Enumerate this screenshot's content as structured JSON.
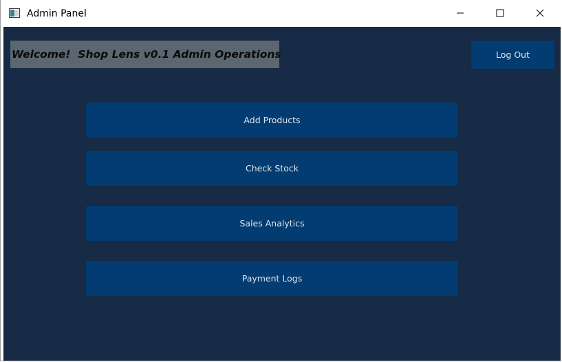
{
  "window": {
    "title": "Admin Panel",
    "icon": "app-window-icon",
    "controls": {
      "minimize": "minimize-icon",
      "maximize": "maximize-icon",
      "close": "close-icon"
    }
  },
  "header": {
    "welcome_text": "Welcome!  Shop Lens v0.1 Admin Operations",
    "logout_label": "Log Out"
  },
  "menu": {
    "items": [
      {
        "label": "Add Products"
      },
      {
        "label": "Check Stock"
      },
      {
        "label": "Sales Analytics"
      },
      {
        "label": "Payment Logs"
      }
    ]
  },
  "colors": {
    "background": "#172a46",
    "button": "#023c70",
    "banner": "#5b6670",
    "button_text": "#dfe6ee"
  }
}
